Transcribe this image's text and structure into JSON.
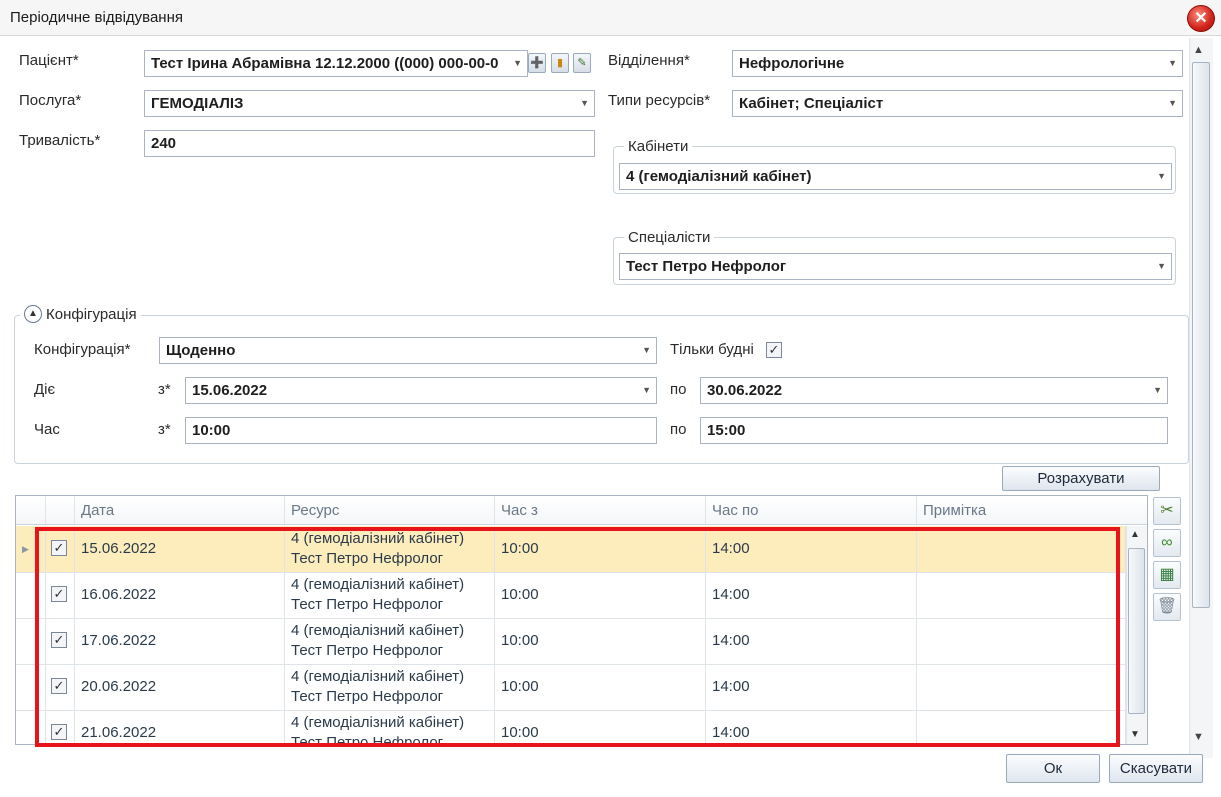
{
  "window": {
    "title": "Періодичне відвідування"
  },
  "patient": {
    "label": "Пацієнт*",
    "value": "Тест Ірина Абрамівна 12.12.2000 ((000) 000-00-0"
  },
  "service": {
    "label": "Послуга*",
    "value": "ГЕМОДІАЛІЗ"
  },
  "duration": {
    "label": "Тривалість*",
    "value": "240"
  },
  "department": {
    "label": "Відділення*",
    "value": "Нефрологічне"
  },
  "resource_types": {
    "label": "Типи ресурсів*",
    "value": "Кабінет; Спеціаліст"
  },
  "cabinets": {
    "legend": "Кабінети",
    "value": "4 (гемодіалізний кабінет)"
  },
  "specialists": {
    "legend": "Спеціалісти",
    "value": "Тест Петро Нефролог"
  },
  "config": {
    "legend": "Конфігурація",
    "config_label": "Конфігурація*",
    "config_value": "Щоденно",
    "weekdays_label": "Тільки будні",
    "weekdays_checked": "✓",
    "acts_label": "Діє",
    "from_label": "з*",
    "to_label": "по",
    "date_from": "15.06.2022",
    "date_to": "30.06.2022",
    "time_label": "Час",
    "time_from": "10:00",
    "time_to": "15:00"
  },
  "calculate_button": "Розрахувати",
  "grid": {
    "columns": [
      "Дата",
      "Ресурс",
      "Час з",
      "Час по",
      "Примітка"
    ],
    "rows": [
      {
        "checked": "✓",
        "date": "15.06.2022",
        "res1": "4 (гемодіалізний кабінет)",
        "res2": "Тест Петро Нефролог",
        "from": "10:00",
        "to": "14:00",
        "note": ""
      },
      {
        "checked": "✓",
        "date": "16.06.2022",
        "res1": "4 (гемодіалізний кабінет)",
        "res2": "Тест Петро Нефролог",
        "from": "10:00",
        "to": "14:00",
        "note": ""
      },
      {
        "checked": "✓",
        "date": "17.06.2022",
        "res1": "4 (гемодіалізний кабінет)",
        "res2": "Тест Петро Нефролог",
        "from": "10:00",
        "to": "14:00",
        "note": ""
      },
      {
        "checked": "✓",
        "date": "20.06.2022",
        "res1": "4 (гемодіалізний кабінет)",
        "res2": "Тест Петро Нефролог",
        "from": "10:00",
        "to": "14:00",
        "note": ""
      },
      {
        "checked": "✓",
        "date": "21.06.2022",
        "res1": "4 (гемодіалізний кабінет)",
        "res2": "Тест Петро Нефролог",
        "from": "10:00",
        "to": "14:00",
        "note": ""
      }
    ]
  },
  "footer": {
    "ok": "Ок",
    "cancel": "Скасувати"
  },
  "colors": {
    "highlight": "#e8141c",
    "selected_row": "#fdedbd"
  }
}
